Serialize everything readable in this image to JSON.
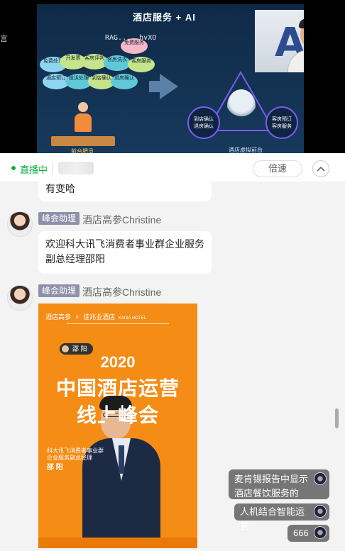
{
  "video": {
    "slide_title": "酒店服务 + AI",
    "overlay_text": "RAG... .hvXO",
    "left_edge_glyph": "言",
    "bubbles": [
      {
        "text": "免费服务"
      },
      {
        "text": "免费处理"
      },
      {
        "text": "开发票"
      },
      {
        "text": "客房评判"
      },
      {
        "text": "客房洗衣"
      },
      {
        "text": "客房服务"
      },
      {
        "text": "酒店预订"
      },
      {
        "text": "投诉处理"
      },
      {
        "text": "到店确认"
      },
      {
        "text": "退房确认"
      }
    ],
    "desk_label": "前台肥员",
    "nodes": [
      {
        "text": "到店确认\n退房确认"
      },
      {
        "text": "客房预订\n客房服务"
      }
    ],
    "platform_label": "酒店虚拟前台"
  },
  "status": {
    "live_label": "直播中",
    "speed_label": "倍速"
  },
  "chat": {
    "messages": [
      {
        "text": "有变哈"
      },
      {
        "badge": "峰会助理",
        "sender": "酒店高参Christine",
        "text_line1": "欢迎科大讯飞消费者事业群企业服务",
        "text_line2": "副总经理邵阳"
      },
      {
        "badge": "峰会助理",
        "sender": "酒店高参Christine"
      }
    ]
  },
  "poster": {
    "logo_left": "酒店高参",
    "logo_x": "×",
    "logo_right": "佳兆业酒店",
    "logo_right_sub": "KAISA HOTEL",
    "speaker_pill": "邵 阳",
    "year": "2020",
    "title_line1": "中国酒店运营",
    "title_line2": "线上峰会",
    "sub1": "科大讯飞消费者事业群",
    "sub2": "企业服务副总经理",
    "name": "邵 阳"
  },
  "danmaku": [
    {
      "line1": "麦肯锡报告中显示",
      "line2": "酒店餐饮服务的A..."
    },
    {
      "text": "人机结合智能运营"
    },
    {
      "text": "666"
    }
  ]
}
